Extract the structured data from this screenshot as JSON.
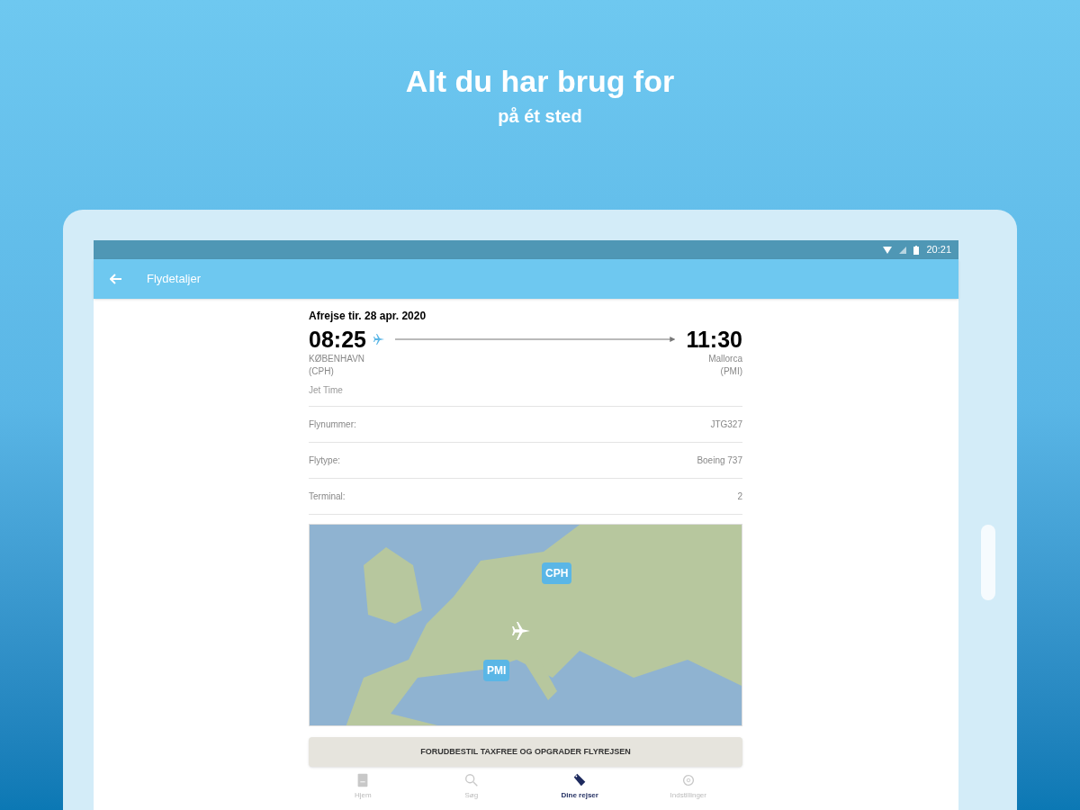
{
  "headline": {
    "title": "Alt du har brug for",
    "subtitle": "på ét sted"
  },
  "status_bar": {
    "time": "20:21"
  },
  "app_bar": {
    "title": "Flydetaljer"
  },
  "flight": {
    "date": "Afrejse tir. 28 apr. 2020",
    "departure_time": "08:25",
    "arrival_time": "11:30",
    "origin_city": "KØBENHAVN",
    "origin_code": "(CPH)",
    "destination_city": "Mallorca",
    "destination_code": "(PMI)",
    "airline": "Jet Time"
  },
  "details": [
    {
      "label": "Flynummer:",
      "value": "JTG327"
    },
    {
      "label": "Flytype:",
      "value": "Boeing 737"
    },
    {
      "label": "Terminal:",
      "value": "2"
    }
  ],
  "map": {
    "markers": [
      {
        "label": "CPH",
        "kind": "origin"
      },
      {
        "label": "PMI",
        "kind": "destination"
      }
    ]
  },
  "action_button": "FORUDBESTIL TAXFREE OG OPGRADER FLYREJSEN",
  "bottom_nav": [
    {
      "label": "Hjem",
      "selected": false
    },
    {
      "label": "Søg",
      "selected": false
    },
    {
      "label": "Dine rejser",
      "selected": true
    },
    {
      "label": "Indstillinger",
      "selected": false
    }
  ]
}
